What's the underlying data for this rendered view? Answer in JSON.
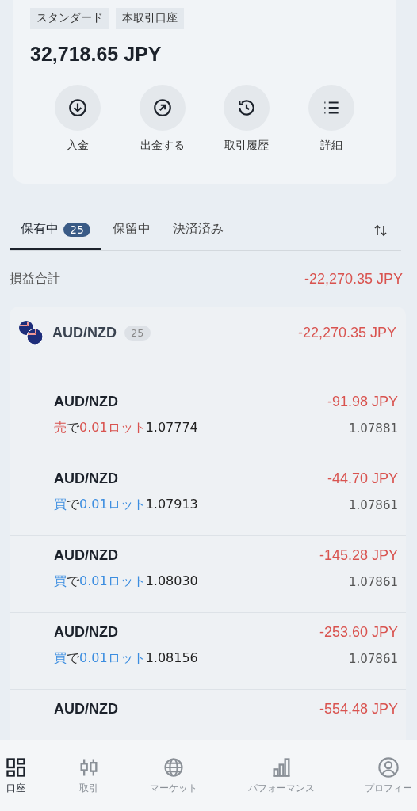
{
  "account": {
    "tags": [
      "スタンダード",
      "本取引口座"
    ],
    "balance": "32,718.65 JPY",
    "actions": [
      {
        "label": "入金"
      },
      {
        "label": "出金する"
      },
      {
        "label": "取引履歴"
      },
      {
        "label": "詳細"
      }
    ]
  },
  "tabs": [
    {
      "label": "保有中",
      "count": "25",
      "selected": true
    },
    {
      "label": "保留中",
      "selected": false
    },
    {
      "label": "決済済み",
      "selected": false
    }
  ],
  "summary": {
    "label": "損益合計",
    "value": "-22,270.35 JPY"
  },
  "group": {
    "symbol": "AUD/NZD",
    "count": "25",
    "pl": "-22,270.35 JPY"
  },
  "positions": [
    {
      "symbol": "AUD/NZD",
      "pl": "-91.98 JPY",
      "kind": "sell",
      "side_label": "売",
      "particle": "で",
      "lot": "0.01ロット",
      "open_price": "1.07774",
      "current_price": "1.07881"
    },
    {
      "symbol": "AUD/NZD",
      "pl": "-44.70 JPY",
      "kind": "buy",
      "side_label": "買",
      "particle": "で",
      "lot": "0.01ロット",
      "open_price": "1.07913",
      "current_price": "1.07861"
    },
    {
      "symbol": "AUD/NZD",
      "pl": "-145.28 JPY",
      "kind": "buy",
      "side_label": "買",
      "particle": "で",
      "lot": "0.01ロット",
      "open_price": "1.08030",
      "current_price": "1.07861"
    },
    {
      "symbol": "AUD/NZD",
      "pl": "-253.60 JPY",
      "kind": "buy",
      "side_label": "買",
      "particle": "で",
      "lot": "0.01ロット",
      "open_price": "1.08156",
      "current_price": "1.07861"
    },
    {
      "symbol": "AUD/NZD",
      "pl": "-554.48 JPY"
    }
  ],
  "nav": [
    {
      "label": "口座",
      "selected": true
    },
    {
      "label": "取引",
      "selected": false
    },
    {
      "label": "マーケット",
      "selected": false
    },
    {
      "label": "パフォーマンス",
      "selected": false
    },
    {
      "label": "プロフィー",
      "selected": false
    }
  ]
}
